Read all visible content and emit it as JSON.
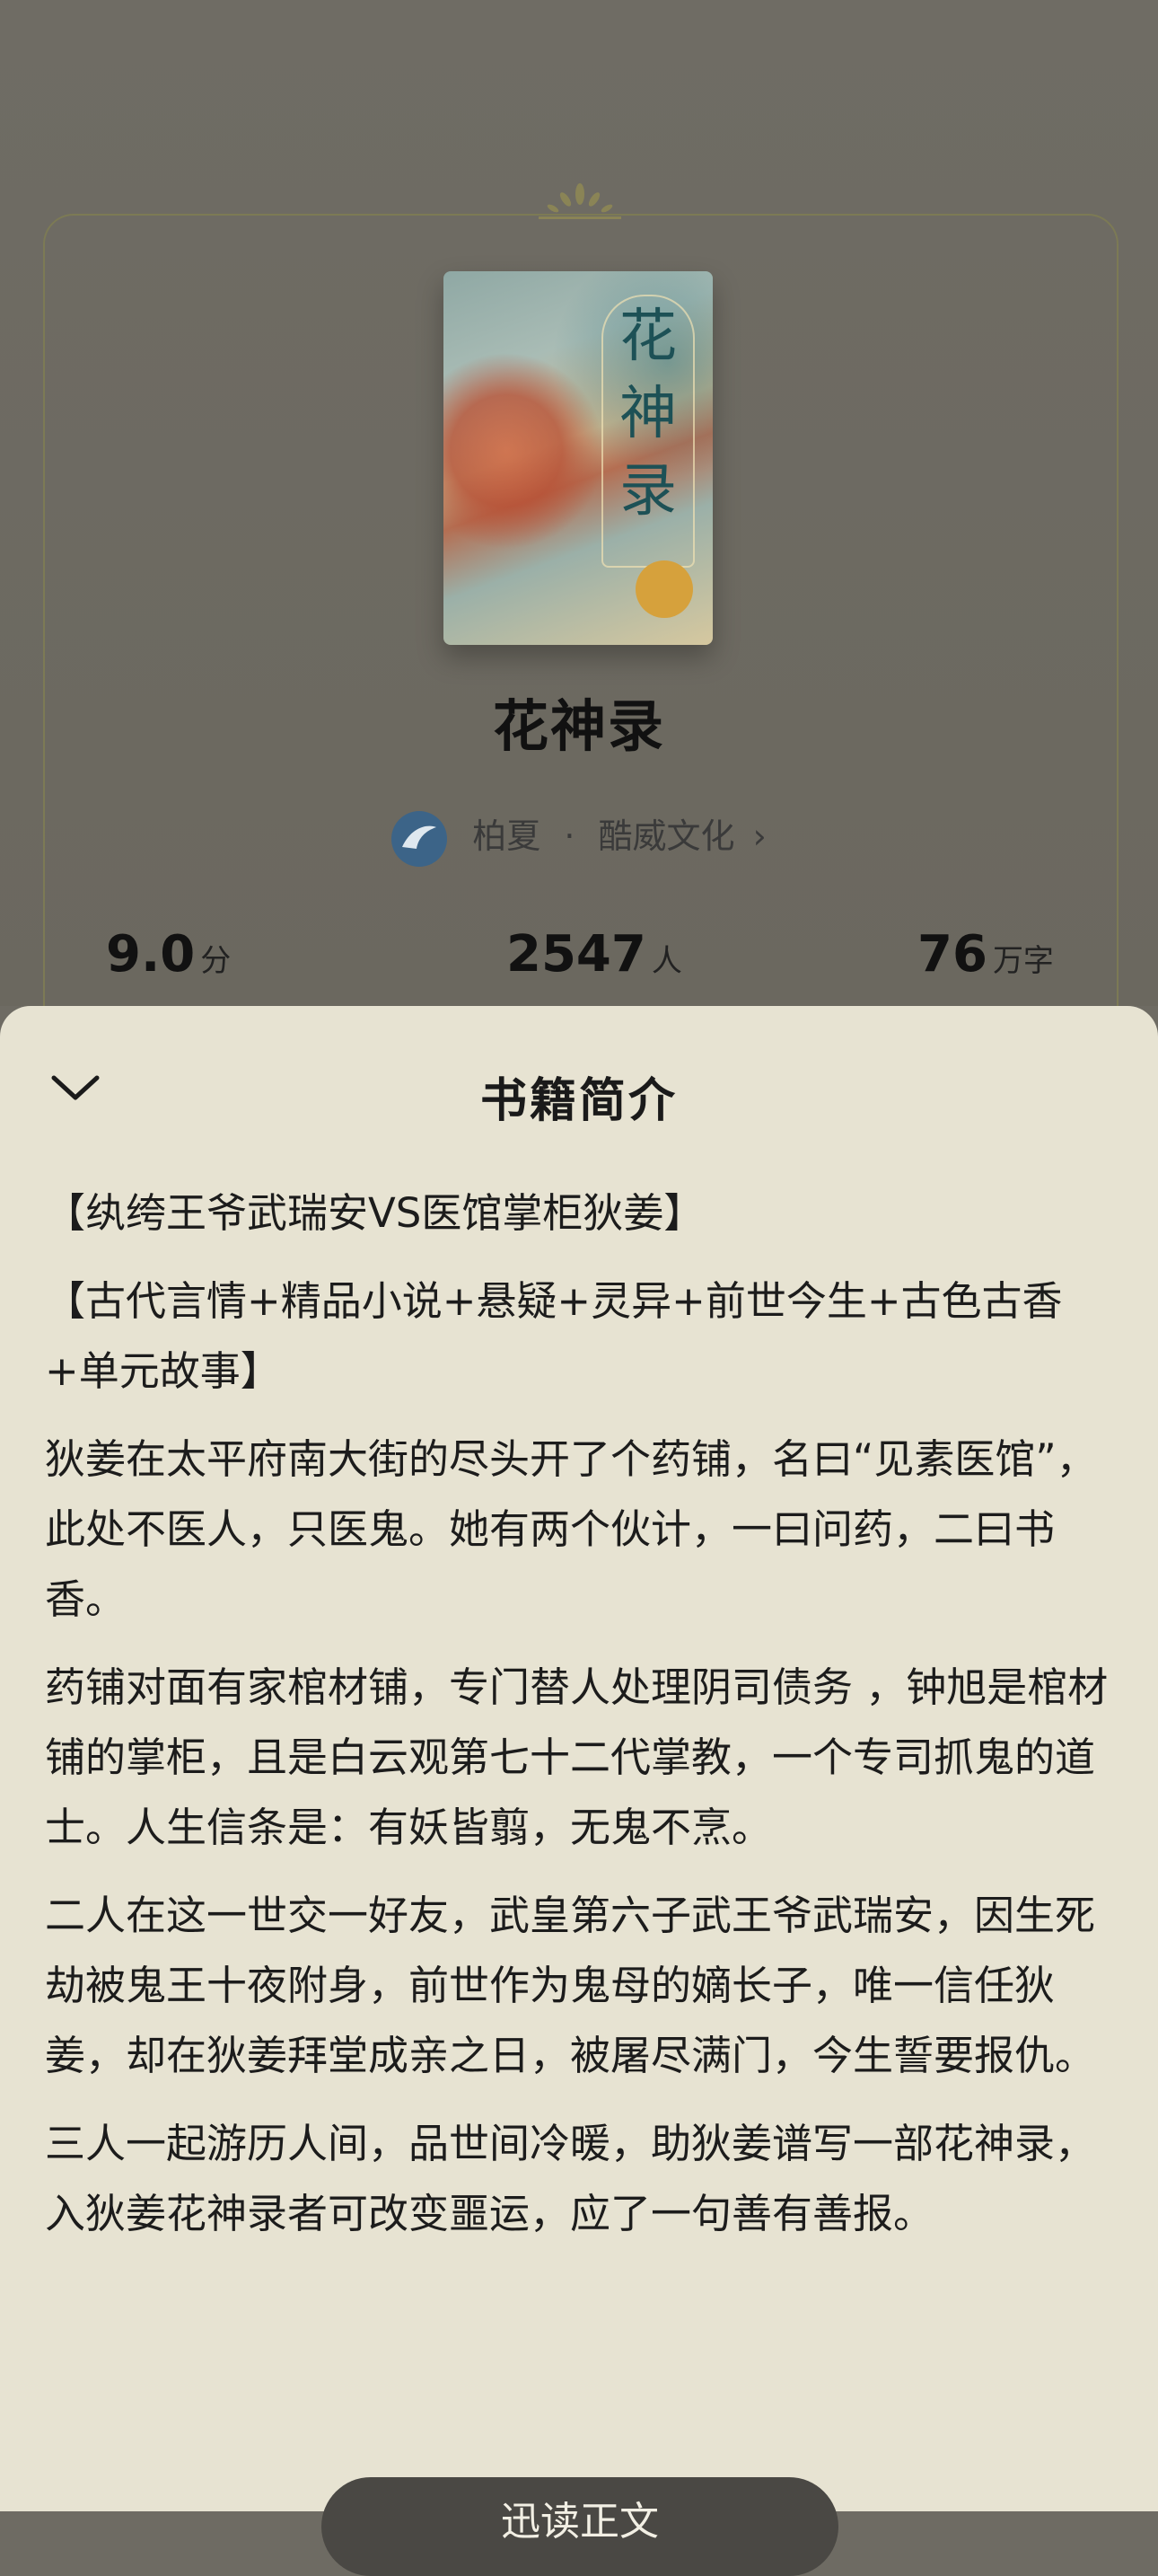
{
  "book": {
    "title": "花神录",
    "cover": {
      "title_art": "花神录"
    },
    "author": "柏夏",
    "separator": "·",
    "publisher": "酷威文化",
    "chevron": "›"
  },
  "stats": [
    {
      "value": "9.0",
      "unit": "分"
    },
    {
      "value": "2547",
      "unit": "人"
    },
    {
      "value": "76",
      "unit": "万字"
    }
  ],
  "sheet": {
    "title": "书籍简介",
    "collapse_icon": "chevron-down-icon",
    "paragraphs": [
      "【纨绔王爷武瑞安VS医馆掌柜狄姜】",
      "【古代言情+精品小说+悬疑+灵异+前世今生+古色古香+单元故事】",
      "狄姜在太平府南大街的尽头开了个药铺，名曰“见素医馆”，此处不医人，只医鬼。她有两个伙计，一曰问药，二曰书香。",
      "药铺对面有家棺材铺，专门替人处理阴司债务 ，钟旭是棺材铺的掌柜，且是白云观第七十二代掌教，一个专司抓鬼的道士。人生信条是：有妖皆翦，无鬼不烹。",
      "二人在这一世交一好友，武皇第六子武王爷武瑞安，因生死劫被鬼王十夜附身，前世作为鬼母的嫡长子，唯一信任狄姜，却在狄姜拜堂成亲之日，被屠尽满门，今生誓要报仇。",
      "三人一起游历人间，品世间冷暖，助狄姜谱写一部花神录，入狄姜花神录者可改变噩运，应了一句善有善报。"
    ],
    "read_button": "迅读正文"
  }
}
